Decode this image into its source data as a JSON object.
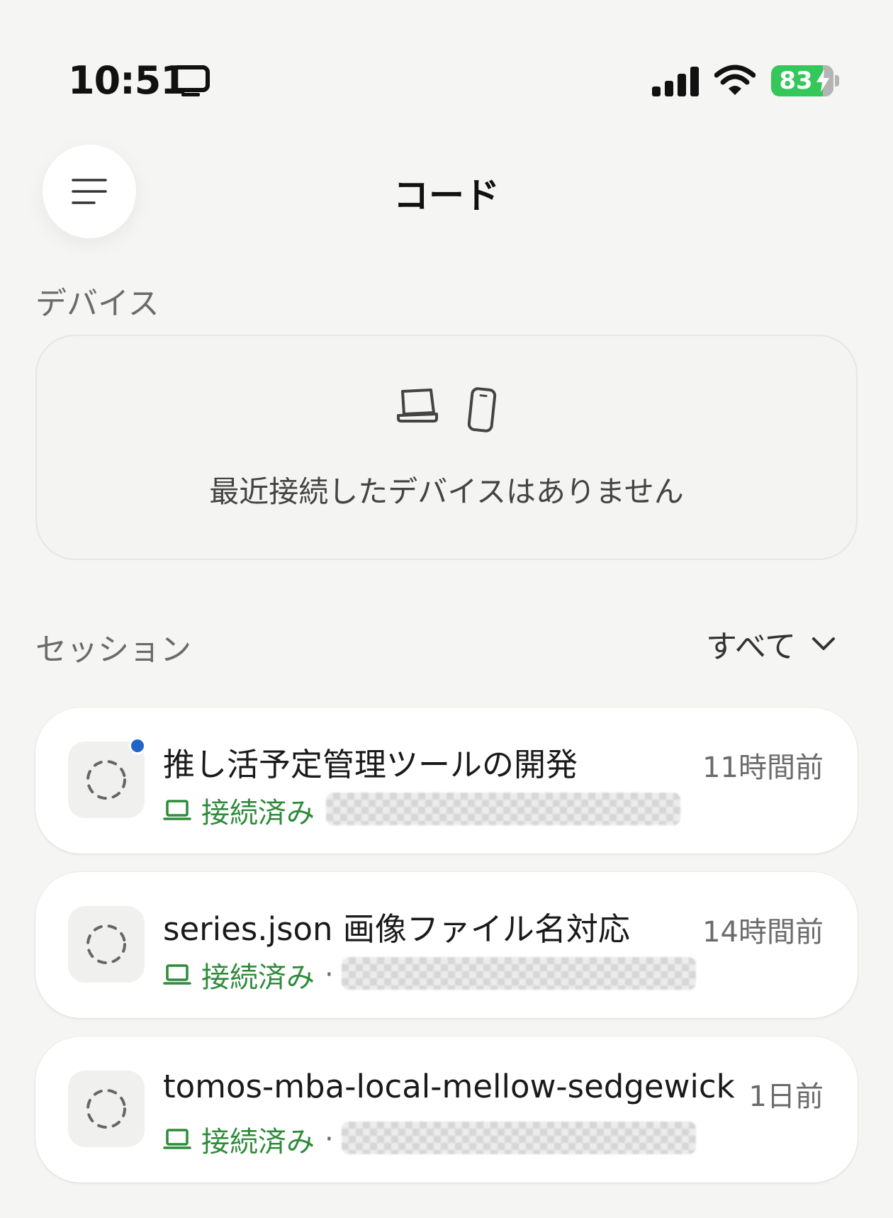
{
  "status_bar": {
    "time": "10:51",
    "battery_percent": 83,
    "battery_label": "83",
    "icons": [
      "tv-icon",
      "cellular-signal-icon",
      "wifi-icon",
      "battery-charging-icon"
    ]
  },
  "header": {
    "title": "コード",
    "menu_icon": "menu-lines-icon"
  },
  "devices": {
    "label": "デバイス",
    "empty_text": "最近接続したデバイスはありません",
    "icons": [
      "laptop-icon",
      "phone-icon"
    ]
  },
  "sessions": {
    "label": "セッション",
    "filter_label": "すべて",
    "items": [
      {
        "title": "推し活予定管理ツールの開発",
        "time": "11時間前",
        "status": "接続済み",
        "separator": "·",
        "unread": true
      },
      {
        "title": "series.json 画像ファイル名対応",
        "time": "14時間前",
        "status": "接続済み",
        "separator": "·",
        "unread": false
      },
      {
        "title": "tomos-mba-local-mellow-sedgewick",
        "time": "1日前",
        "status": "接続済み",
        "separator": "·",
        "unread": false
      }
    ]
  },
  "colors": {
    "background": "#f5f5f4",
    "connected_green": "#2e8b3a",
    "unread_blue": "#1f66c6",
    "battery_green": "#34c759"
  }
}
